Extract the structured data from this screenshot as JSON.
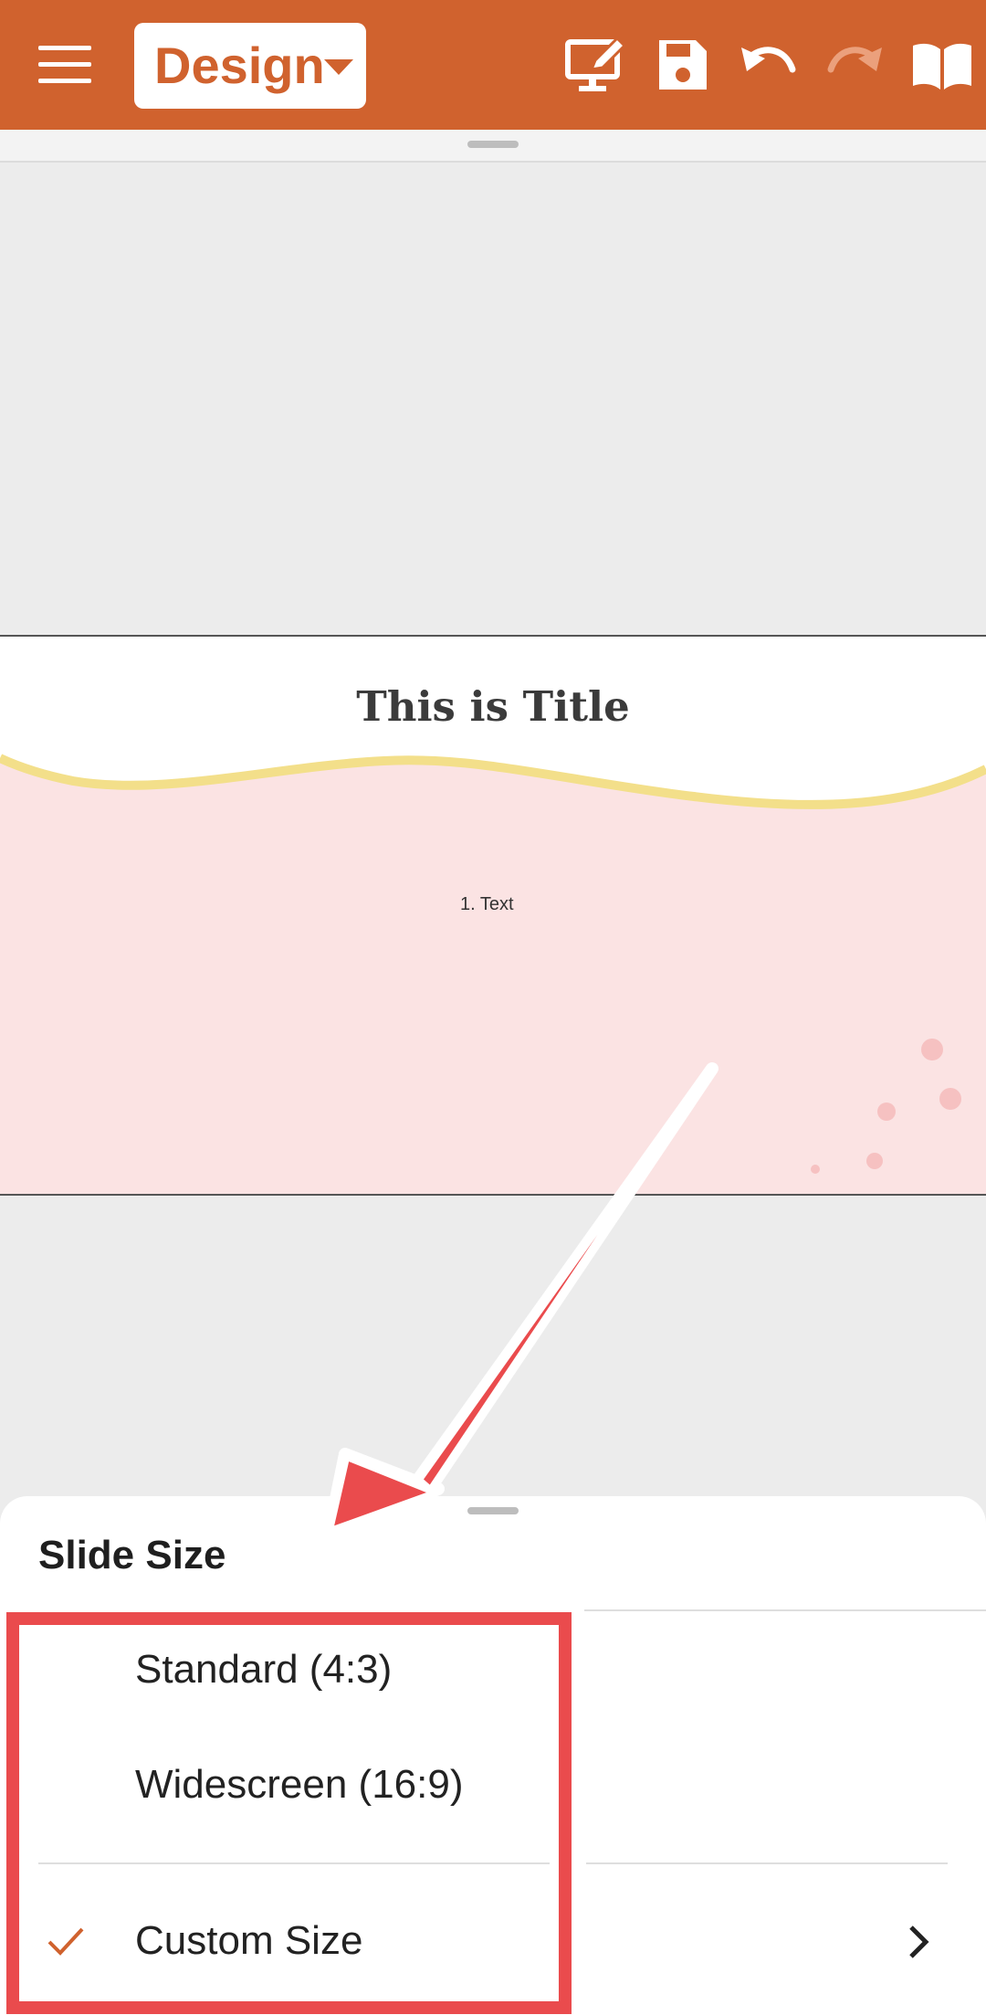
{
  "toolbar": {
    "design_label": "Design",
    "icons": [
      "menu-icon",
      "present-icon",
      "save-icon",
      "undo-icon",
      "redo-icon",
      "read-mode-icon"
    ]
  },
  "slide": {
    "title": "This is Title",
    "body_text": "1.  Text"
  },
  "sheet": {
    "title": "Slide Size",
    "options": [
      {
        "label": "Standard (4:3)",
        "selected": false
      },
      {
        "label": "Widescreen (16:9)",
        "selected": false
      },
      {
        "label": "Custom Size",
        "selected": true
      }
    ]
  },
  "colors": {
    "accent": "#d0622e",
    "annotation": "#ea4b4d",
    "slide_bg": "#fbe3e3",
    "wave": "#f3df8a"
  }
}
